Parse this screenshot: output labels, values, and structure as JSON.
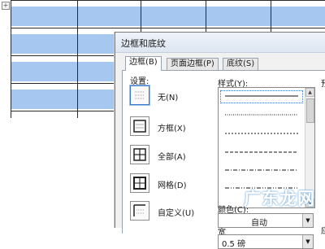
{
  "document": {
    "move_handle": "+"
  },
  "dialog": {
    "title": "边框和底纹",
    "tabs": [
      {
        "label": "边框(B)",
        "active": true
      },
      {
        "label": "页面边框(P)",
        "active": false
      },
      {
        "label": "底纹(S)",
        "active": false
      }
    ],
    "settings_label": "设置:",
    "settings": [
      {
        "label": "无(N)",
        "icon": "none-border-icon",
        "selected": true
      },
      {
        "label": "方框(X)",
        "icon": "box-border-icon",
        "selected": false
      },
      {
        "label": "全部(A)",
        "icon": "all-border-icon",
        "selected": false
      },
      {
        "label": "网格(D)",
        "icon": "grid-border-icon",
        "selected": false
      },
      {
        "label": "自定义(U)",
        "icon": "custom-border-icon",
        "selected": false
      }
    ],
    "style_label": "样式(Y):",
    "styles": [
      "solid",
      "dotted",
      "dashed-short",
      "dashed-long",
      "dash-dot",
      "dash-dot-dot"
    ],
    "color_label": "颜色(C):",
    "color_value": "自动",
    "width_label": "宽",
    "width_value": "0.5 磅",
    "preview_label": "预",
    "apply_label": "应"
  },
  "watermark": {
    "text": "广东龙网"
  },
  "colors": {
    "table_fill": "#a6c8f0",
    "dialog_bg": "#f1f1f1",
    "selection": "#3a78c9"
  }
}
